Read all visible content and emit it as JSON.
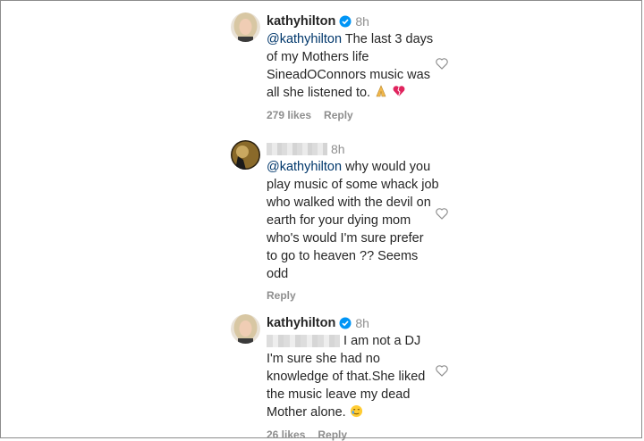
{
  "comments": [
    {
      "username": "kathyhilton",
      "verified": true,
      "time": "8h",
      "mention": "@kathyhilton",
      "lines": [
        "The last 3 days",
        "of my Mothers life",
        "SineadOConnors music was",
        "all she listened to."
      ],
      "emojis": [
        "folded-hands-icon",
        "broken-heart-icon"
      ],
      "likes": "279 likes",
      "reply": "Reply"
    },
    {
      "username": "",
      "verified": false,
      "time": "8h",
      "mention": "@kathyhilton",
      "lines": [
        "why would you",
        "play music of some whack job",
        "who walked with the devil on",
        "earth for your dying mom",
        "who's would I'm sure prefer",
        "to go to heaven ?? Seems",
        "odd"
      ],
      "likes": "",
      "reply": "Reply"
    },
    {
      "username": "kathyhilton",
      "verified": true,
      "time": "8h",
      "mention": "",
      "lines": [
        "I am not a DJ",
        "I'm sure she had no",
        "knowledge of that.She liked",
        "the music leave my dead",
        "Mother alone."
      ],
      "emojis": [
        "crying-face-icon"
      ],
      "likes": "26 likes",
      "reply": "Reply"
    }
  ],
  "colors": {
    "text": "#262626",
    "meta": "#8e8e8e",
    "mention": "#00376b",
    "verified": "#0095f6"
  }
}
